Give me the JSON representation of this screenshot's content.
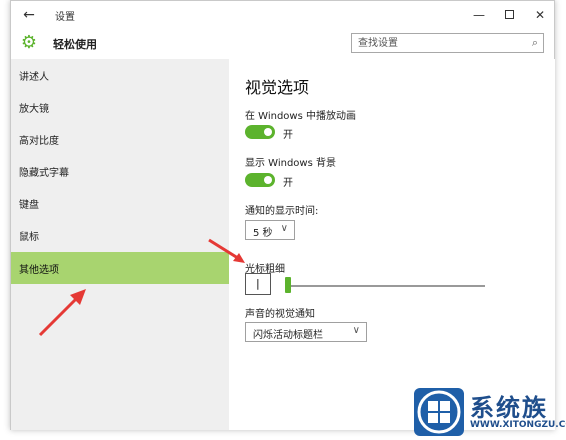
{
  "window": {
    "title": "设置",
    "back_icon": "←",
    "minimize_icon": "—",
    "close_icon": "✕"
  },
  "header": {
    "app_name": "轻松使用",
    "gear_icon": "⚙",
    "search_placeholder": "查找设置",
    "search_icon": "⌕"
  },
  "sidebar": {
    "items": [
      {
        "label": "讲述人"
      },
      {
        "label": "放大镜"
      },
      {
        "label": "高对比度"
      },
      {
        "label": "隐藏式字幕"
      },
      {
        "label": "键盘"
      },
      {
        "label": "鼠标"
      },
      {
        "label": "其他选项",
        "active": true
      }
    ]
  },
  "main": {
    "title": "视觉选项",
    "animations": {
      "label": "在 Windows 中播放动画",
      "state": "开",
      "on": true
    },
    "background": {
      "label": "显示 Windows 背景",
      "state": "开",
      "on": true
    },
    "notification": {
      "label": "通知的显示时间:",
      "value": "5 秒",
      "chevron": "∨"
    },
    "cursor": {
      "label": "光标粗细",
      "value": "|",
      "slider_fraction": 0.0
    },
    "sound": {
      "label": "声音的视觉通知",
      "value": "闪烁活动标题栏",
      "chevron": "∨"
    }
  },
  "colors": {
    "accent": "#5cb32d",
    "active_nav": "#a8d46f",
    "arrow": "#e53935",
    "logo_blue": "#1f5fa8"
  },
  "watermark": {
    "name": "系统族",
    "url": "WWW.XITONGZU.COM"
  }
}
